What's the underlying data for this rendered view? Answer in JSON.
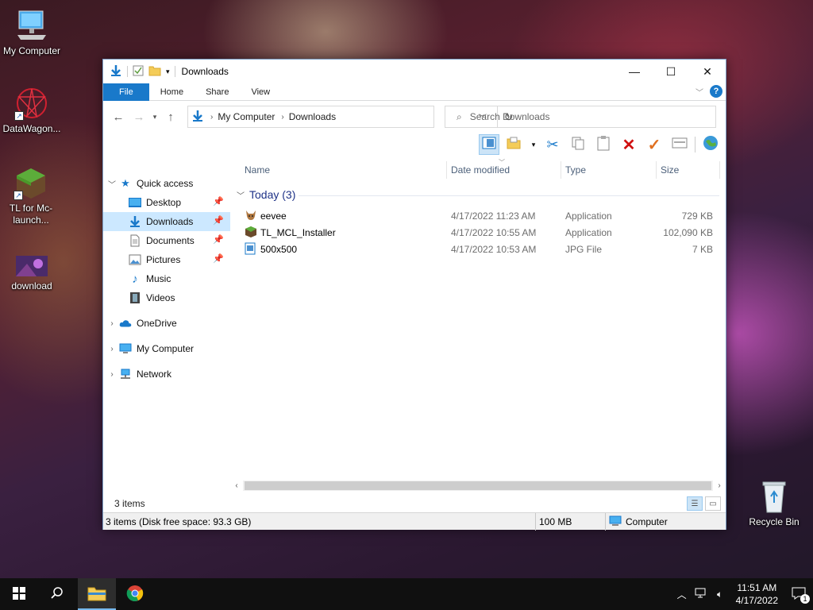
{
  "desktop": {
    "icons": [
      {
        "label": "My Computer"
      },
      {
        "label": "DataWagon..."
      },
      {
        "label": "TL for Mc-launch..."
      },
      {
        "label": "download"
      },
      {
        "label": "Recycle Bin"
      }
    ]
  },
  "window": {
    "title": "Downloads",
    "controls": {
      "minimize": "—",
      "maximize": "☐",
      "close": "✕"
    },
    "ribbon_tabs": [
      "File",
      "Home",
      "Share",
      "View"
    ],
    "address": {
      "parts": [
        "My Computer",
        "Downloads"
      ]
    },
    "search": {
      "placeholder": "Search Downloads"
    },
    "nav_pane": {
      "quick_access": "Quick access",
      "quick_items": [
        "Desktop",
        "Downloads",
        "Documents",
        "Pictures",
        "Music",
        "Videos"
      ],
      "onedrive": "OneDrive",
      "my_computer": "My Computer",
      "network": "Network"
    },
    "columns": {
      "name": "Name",
      "date": "Date modified",
      "type": "Type",
      "size": "Size"
    },
    "group": "Today (3)",
    "files": [
      {
        "name": "eevee",
        "date": "4/17/2022 11:23 AM",
        "type": "Application",
        "size": "729 KB"
      },
      {
        "name": "TL_MCL_Installer",
        "date": "4/17/2022 10:55 AM",
        "type": "Application",
        "size": "102,090 KB"
      },
      {
        "name": "500x500",
        "date": "4/17/2022 10:53 AM",
        "type": "JPG File",
        "size": "7 KB"
      }
    ],
    "status_items": "3 items",
    "status_disk": "3 items (Disk free space: 93.3 GB)",
    "status_size": "100 MB",
    "status_location": "Computer"
  },
  "taskbar": {
    "time": "11:51 AM",
    "date": "4/17/2022",
    "notification_count": "1"
  },
  "colors": {
    "accent": "#1979ca",
    "selection": "#cce8ff",
    "taskbar": "#101010"
  }
}
